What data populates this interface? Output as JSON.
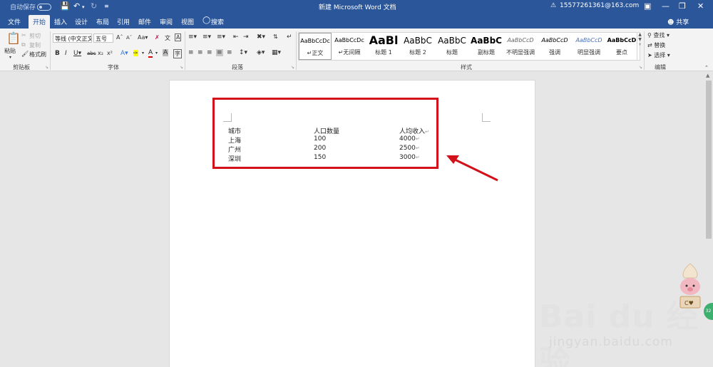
{
  "titlebar": {
    "autosave_label": "自动保存",
    "toggle_state": "关",
    "doc_title": "新建 Microsoft Word 文档",
    "account": "15577261361@163.com"
  },
  "tabs": [
    {
      "label": "文件"
    },
    {
      "label": "开始"
    },
    {
      "label": "插入"
    },
    {
      "label": "设计"
    },
    {
      "label": "布局"
    },
    {
      "label": "引用"
    },
    {
      "label": "邮件"
    },
    {
      "label": "审阅"
    },
    {
      "label": "视图"
    }
  ],
  "search_label": "搜索",
  "share_label": "共享",
  "clipboard": {
    "paste": "粘贴",
    "cut": "剪切",
    "copy": "复制",
    "format_painter": "格式刷",
    "group": "剪贴板"
  },
  "font": {
    "font_name": "等线 (中文正文)",
    "font_size": "五号",
    "group": "字体"
  },
  "paragraph": {
    "group": "段落"
  },
  "styles": {
    "group": "样式",
    "items": [
      {
        "preview": "AaBbCcDc",
        "label": "正文"
      },
      {
        "preview": "AaBbCcDc",
        "label": "无间隔"
      },
      {
        "preview": "AaBl",
        "label": "标题 1"
      },
      {
        "preview": "AaBbC",
        "label": "标题 2"
      },
      {
        "preview": "AaBbC",
        "label": "标题"
      },
      {
        "preview": "AaBbC",
        "label": "副标题"
      },
      {
        "preview": "AaBbCcD",
        "label": "不明显强调"
      },
      {
        "preview": "AaBbCcD",
        "label": "强调"
      },
      {
        "preview": "AaBbCcD",
        "label": "明显强调"
      },
      {
        "preview": "AaBbCcD",
        "label": "要点"
      }
    ]
  },
  "editing": {
    "find": "查找",
    "replace": "替换",
    "select": "选择",
    "group": "编辑"
  },
  "document": {
    "rows": [
      [
        "城市",
        "人口数量",
        "人均收入"
      ],
      [
        "上海",
        "100",
        "4000"
      ],
      [
        "广州",
        "200",
        "2500"
      ],
      [
        "深圳",
        "150",
        "3000"
      ]
    ]
  },
  "watermark": {
    "brand": "Bai du 经验",
    "url": "jingyan.baidu.com"
  }
}
